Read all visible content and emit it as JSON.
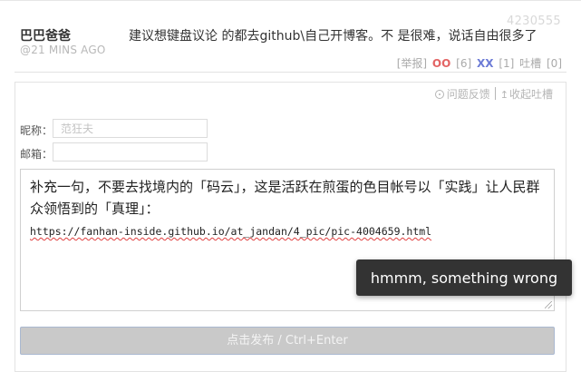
{
  "comment": {
    "id": "4230555",
    "author": "巴巴爸爸",
    "time": "@21 MINS AGO",
    "text": "建议想键盘议论 的都去github\\自己开博客。不 是很难，说话自由很多了",
    "report_label": "[举报]",
    "oo_label": "OO",
    "oo_count": "[6]",
    "xx_label": "XX",
    "xx_count": "[1]",
    "tucao_label": "吐槽",
    "tucao_count": "[0]"
  },
  "reply": {
    "feedback_label": "问题反馈",
    "collapse_label": "收起吐槽",
    "nickname_label": "昵称：",
    "nickname_placeholder": "范狂夫",
    "email_label": "邮箱：",
    "email_placeholder": "",
    "body_line1": "补充一句，不要去找境内的「码云」，这是活跃在煎蛋的色目帐号以「实践」让人民群众领悟到的「真理」：",
    "body_link": "https://fanhan-inside.github.io/at_jandan/4_pic/pic-4004659.html",
    "submit_label": "点击发布 / Ctrl+Enter"
  },
  "toast": {
    "message": "hmmm, something wrong"
  },
  "colors": {
    "oo": "#e36464",
    "xx": "#6c7bd6",
    "toast_bg": "#333333",
    "submit_bg": "#c9c9c9"
  },
  "icons": {
    "feedback": "circle-dot-icon",
    "collapse": "up-arrow-icon"
  }
}
